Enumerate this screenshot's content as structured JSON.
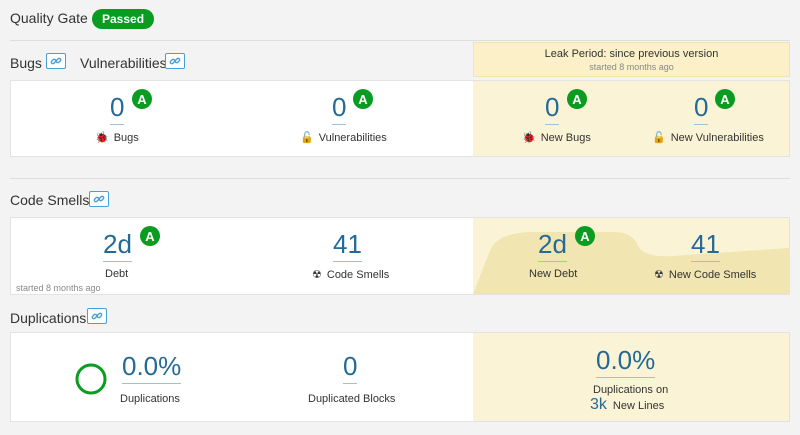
{
  "quality_gate": {
    "title": "Quality Gate",
    "status": "Passed"
  },
  "bugs_section": {
    "bugs_title": "Bugs",
    "vuln_title": "Vulnerabilities"
  },
  "leak": {
    "title": "Leak Period: since previous version",
    "subtitle": "started 8 months ago"
  },
  "bugs": {
    "value": "0",
    "grade": "A",
    "label": "Bugs"
  },
  "vulnerabilities": {
    "value": "0",
    "grade": "A",
    "label": "Vulnerabilities"
  },
  "new_bugs": {
    "value": "0",
    "grade": "A",
    "label": "New Bugs"
  },
  "new_vulnerabilities": {
    "value": "0",
    "grade": "A",
    "label": "New Vulnerabilities"
  },
  "code_smells_section": {
    "title": "Code Smells"
  },
  "debt": {
    "value": "2d",
    "grade": "A",
    "label": "Debt",
    "started": "started 8 months ago"
  },
  "code_smells": {
    "value": "41",
    "label": "Code Smells"
  },
  "new_debt": {
    "value": "2d",
    "grade": "A",
    "label": "New Debt"
  },
  "new_code_smells": {
    "value": "41",
    "label": "New Code Smells"
  },
  "duplications_section": {
    "title": "Duplications"
  },
  "duplications": {
    "value": "0.0%",
    "label": "Duplications"
  },
  "duplicated_blocks": {
    "value": "0",
    "label": "Duplicated Blocks"
  },
  "new_duplications": {
    "value": "0.0%",
    "label": "Duplications on",
    "lines_value": "3k",
    "lines_label": "New Lines"
  },
  "colors": {
    "accent": "#236a97",
    "pass": "#0a9c20",
    "leak_bg": "#fbf3d5"
  }
}
